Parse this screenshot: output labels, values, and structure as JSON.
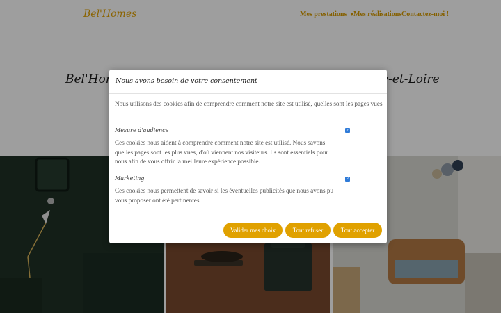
{
  "header": {
    "logo": "Bel'Homes",
    "nav": [
      {
        "label": "Mes prestations"
      },
      {
        "label": "Mes réalisations"
      },
      {
        "label": "Contactez-moi !"
      }
    ]
  },
  "hero": {
    "title_left": "Bel'Homes",
    "title_right": "e-et-Loire"
  },
  "modal": {
    "title": "Nous avons besoin de votre consentement",
    "intro": "Nous utilisons des cookies afin de comprendre comment notre site est utilisé, quelles sont les pages vues",
    "sections": [
      {
        "title": "Mesure d'audience",
        "description": "Ces cookies nous aident à comprendre comment notre site est utilisé. Nous savons quelles pages sont les plus vues, d'où viennent nos visiteurs. Ils sont essentiels pour nous afin de vous offrir la meilleure expérience possible.",
        "checked": true
      },
      {
        "title": "Marketing",
        "description": "Ces cookies nous permettent de savoir si les éventuelles publicités que nous avons pu vous proposer ont été pertinentes.",
        "checked": true
      }
    ],
    "buttons": {
      "validate": "Valider mes choix",
      "refuse": "Tout refuser",
      "accept": "Tout accepter"
    }
  },
  "colors": {
    "accent": "#e0a100",
    "overlay": "rgba(0,0,0,0.38)",
    "checkbox": "#2f7bd8"
  }
}
